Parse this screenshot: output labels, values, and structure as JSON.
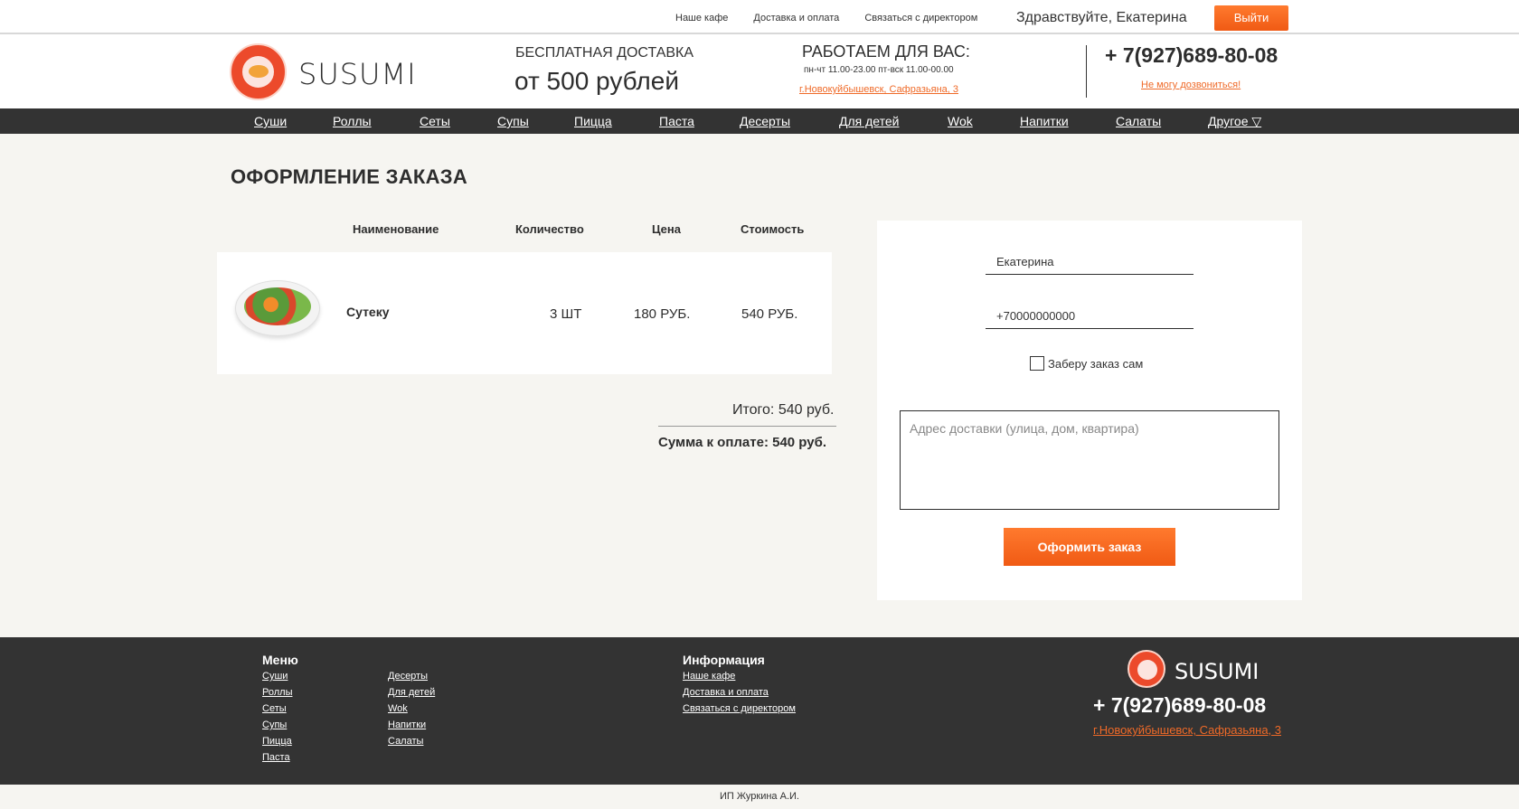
{
  "topbar": {
    "links": [
      "Наше кафе",
      "Доставка и оплата",
      "Связаться с директором"
    ],
    "greeting": "Здравствуйте, Екатерина",
    "logout": "Выйти"
  },
  "header": {
    "logo_text": "SUSUMI",
    "free_delivery": "БЕСПЛАТНАЯ ДОСТАВКА",
    "free_delivery_sum": "от 500 рублей",
    "work_title": "РАБОТАЕМ ДЛЯ ВАС:",
    "work_hours": "пн-чт 11.00-23.00 пт-вск 11.00-00.00",
    "address": "г.Новокуйбышевск, Сафразьяна, 3",
    "phone": "+ 7(927)689-80-08",
    "cant_call": "Не могу дозвониться!"
  },
  "nav": [
    "Суши",
    "Роллы",
    "Сеты",
    "Супы",
    "Пицца",
    "Паста",
    "Десерты",
    "Для детей",
    "Wok",
    "Напитки",
    "Салаты",
    "Другое ▽"
  ],
  "main": {
    "title": "ОФОРМЛЕНИЕ ЗАКАЗА",
    "columns": [
      "Наименование",
      "Количество",
      "Цена",
      "Стоимость"
    ],
    "items": [
      {
        "name": "Сутеку",
        "qty": "3 ШТ",
        "price": "180 РУБ.",
        "cost": "540 РУБ."
      }
    ],
    "total": "Итого: 540 руб.",
    "to_pay": "Сумма к оплате: 540 руб."
  },
  "form": {
    "name_value": "Екатерина",
    "phone_value": "+70000000000",
    "pickup_label": "Заберу заказ сам",
    "pickup_checked": false,
    "address_placeholder": "Адрес доставки (улица, дом, квартира)",
    "submit": "Оформить заказ"
  },
  "footer": {
    "menu_title": "Меню",
    "menu_col1": [
      "Суши",
      "Роллы",
      "Сеты",
      "Супы",
      "Пицца",
      "Паста"
    ],
    "menu_col2": [
      "Десерты",
      "Для детей",
      "Wok",
      "Напитки",
      "Салаты"
    ],
    "info_title": "Информация",
    "info_links": [
      "Наше кафе",
      "Доставка и оплата",
      "Связаться с директором"
    ],
    "logo_text": "SUSUMI",
    "phone": "+ 7(927)689-80-08",
    "address": "г.Новокуйбышевск, Сафразьяна, 3"
  },
  "copyright": "ИП Журкина А.И.",
  "colors": {
    "accent": "#f05a14",
    "dark": "#333333",
    "background": "#f6f5f1"
  }
}
